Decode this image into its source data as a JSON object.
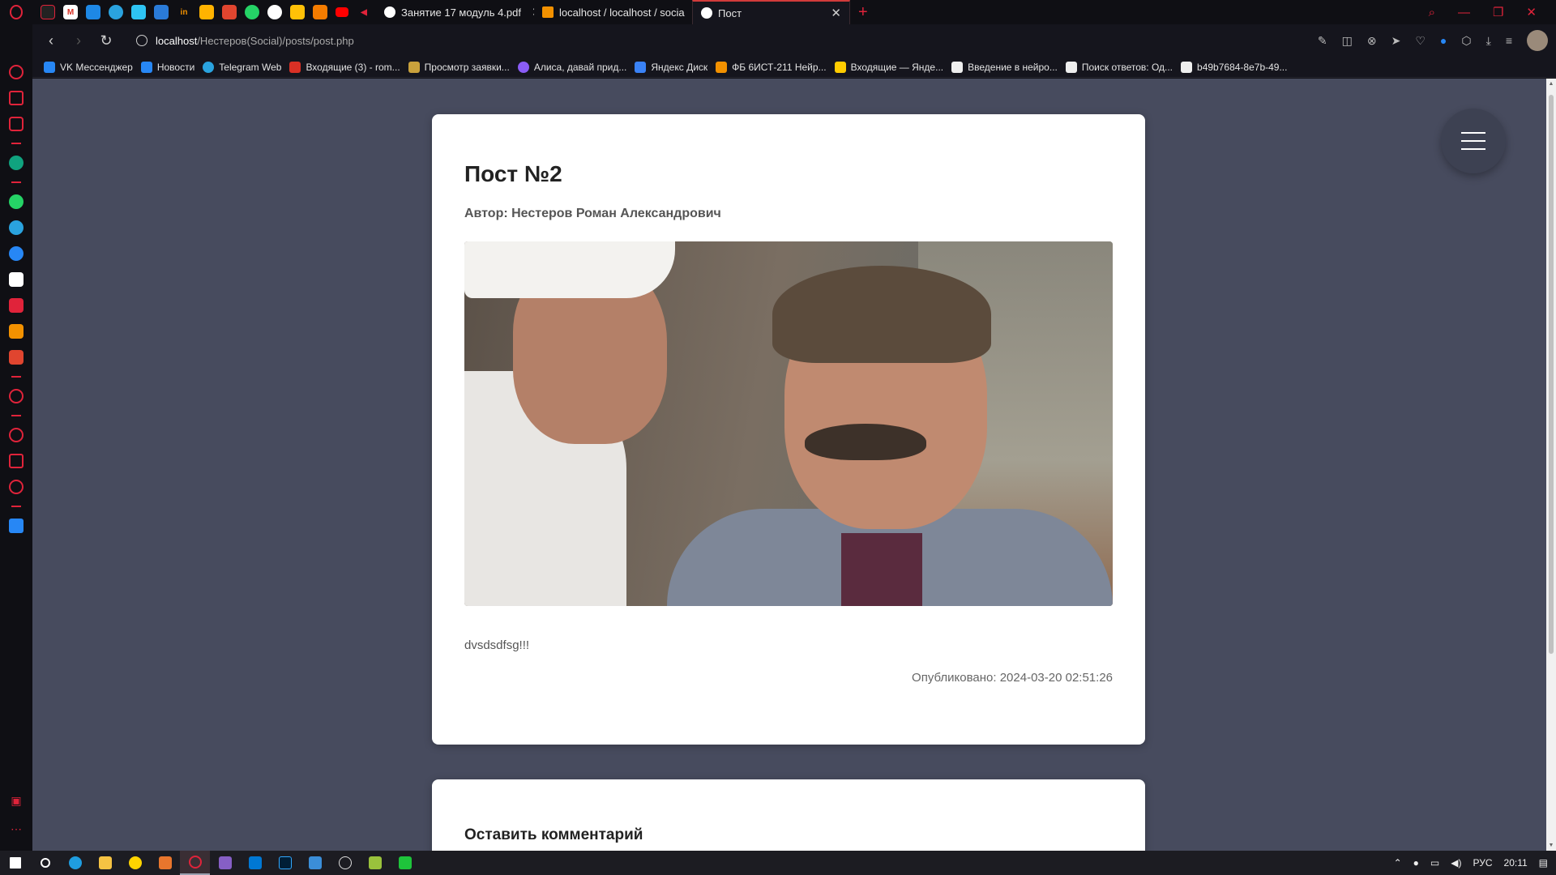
{
  "tabs": [
    {
      "title": "Занятие 17 модуль 4.pdf",
      "active": false
    },
    {
      "title": "localhost / localhost / socia",
      "active": false
    },
    {
      "title": "Пост",
      "active": true
    }
  ],
  "address": {
    "host": "localhost",
    "path": "/Нестеров(Social)/posts/post.php"
  },
  "bookmarks": [
    {
      "label": "VK Мессенджер",
      "color": "#2787f5"
    },
    {
      "label": "Новости",
      "color": "#2787f5"
    },
    {
      "label": "Telegram Web",
      "color": "#2aa3df"
    },
    {
      "label": "Входящие (3) - rom...",
      "color": "#d93025"
    },
    {
      "label": "Просмотр заявки...",
      "color": "#c9a13c"
    },
    {
      "label": "Алиса, давай прид...",
      "color": "#8a5cf6"
    },
    {
      "label": "Яндекс Диск",
      "color": "#3a82f6"
    },
    {
      "label": "ФБ 6ИСТ-211 Нейр...",
      "color": "#f29100"
    },
    {
      "label": "Входящие — Янде...",
      "color": "#ffcc00"
    },
    {
      "label": "Введение в нейро...",
      "color": "#eeeeee"
    },
    {
      "label": "Поиск ответов: Од...",
      "color": "#eeeeee"
    },
    {
      "label": "b49b7684-8e7b-49...",
      "color": "#eeeeee"
    }
  ],
  "post": {
    "title": "Пост №2",
    "author": "Автор: Нестеров Роман Александрович",
    "content": "dvsdsdfsg!!!",
    "published": "Опубликовано: 2024-03-20 02:51:26"
  },
  "comment_section": {
    "title": "Оставить комментарий"
  },
  "taskbar": {
    "language": "РУС",
    "time": "20:11"
  },
  "colors": {
    "page_bg": "#474b5e",
    "accent": "#e0233a",
    "card_bg": "#ffffff"
  }
}
